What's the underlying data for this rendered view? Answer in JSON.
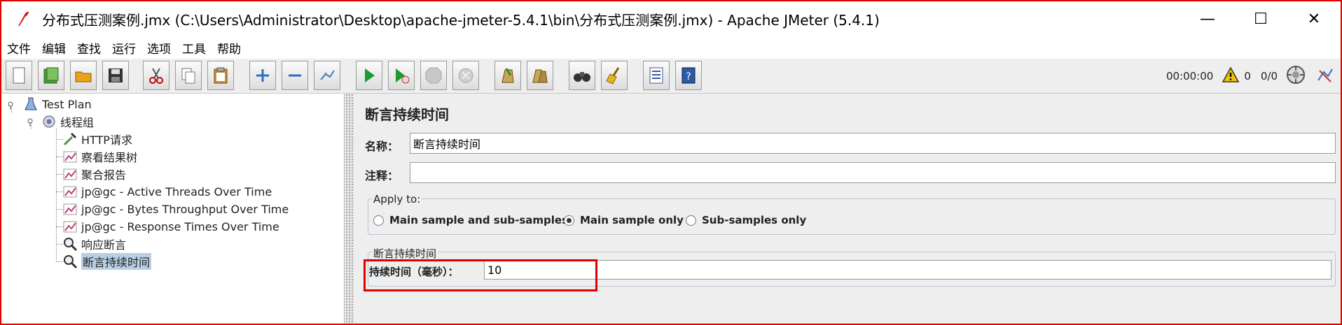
{
  "window": {
    "title": "分布式压测案例.jmx (C:\\Users\\Administrator\\Desktop\\apache-jmeter-5.4.1\\bin\\分布式压测案例.jmx) - Apache JMeter (5.4.1)",
    "minimize": "—",
    "maximize": "☐",
    "close": "✕"
  },
  "menu": [
    "文件",
    "编辑",
    "查找",
    "运行",
    "选项",
    "工具",
    "帮助"
  ],
  "toolbar": {
    "timer": "00:00:00",
    "warning_count": "0",
    "threads": "0/0"
  },
  "tree": {
    "root": "Test Plan",
    "thread_group": "线程组",
    "children": [
      "HTTP请求",
      "察看结果树",
      "聚合报告",
      "jp@gc - Active Threads Over Time",
      "jp@gc - Bytes Throughput Over Time",
      "jp@gc - Response Times Over Time",
      "响应断言",
      "断言持续时间"
    ],
    "selected": "断言持续时间"
  },
  "detail": {
    "title": "断言持续时间",
    "name_label": "名称：",
    "name_value": "断言持续时间",
    "comment_label": "注释：",
    "comment_value": "",
    "apply_to": {
      "legend": "Apply to:",
      "options": [
        "Main sample and sub-samples",
        "Main sample only",
        "Sub-samples only"
      ],
      "selected": "Main sample only"
    },
    "duration_group": {
      "legend": "断言持续时间",
      "label": "持续时间（毫秒）：",
      "value": "10"
    }
  },
  "colors": {
    "highlight": "#e00000",
    "selection": "#b8cfe5",
    "panel_bg": "#eeeeee"
  }
}
